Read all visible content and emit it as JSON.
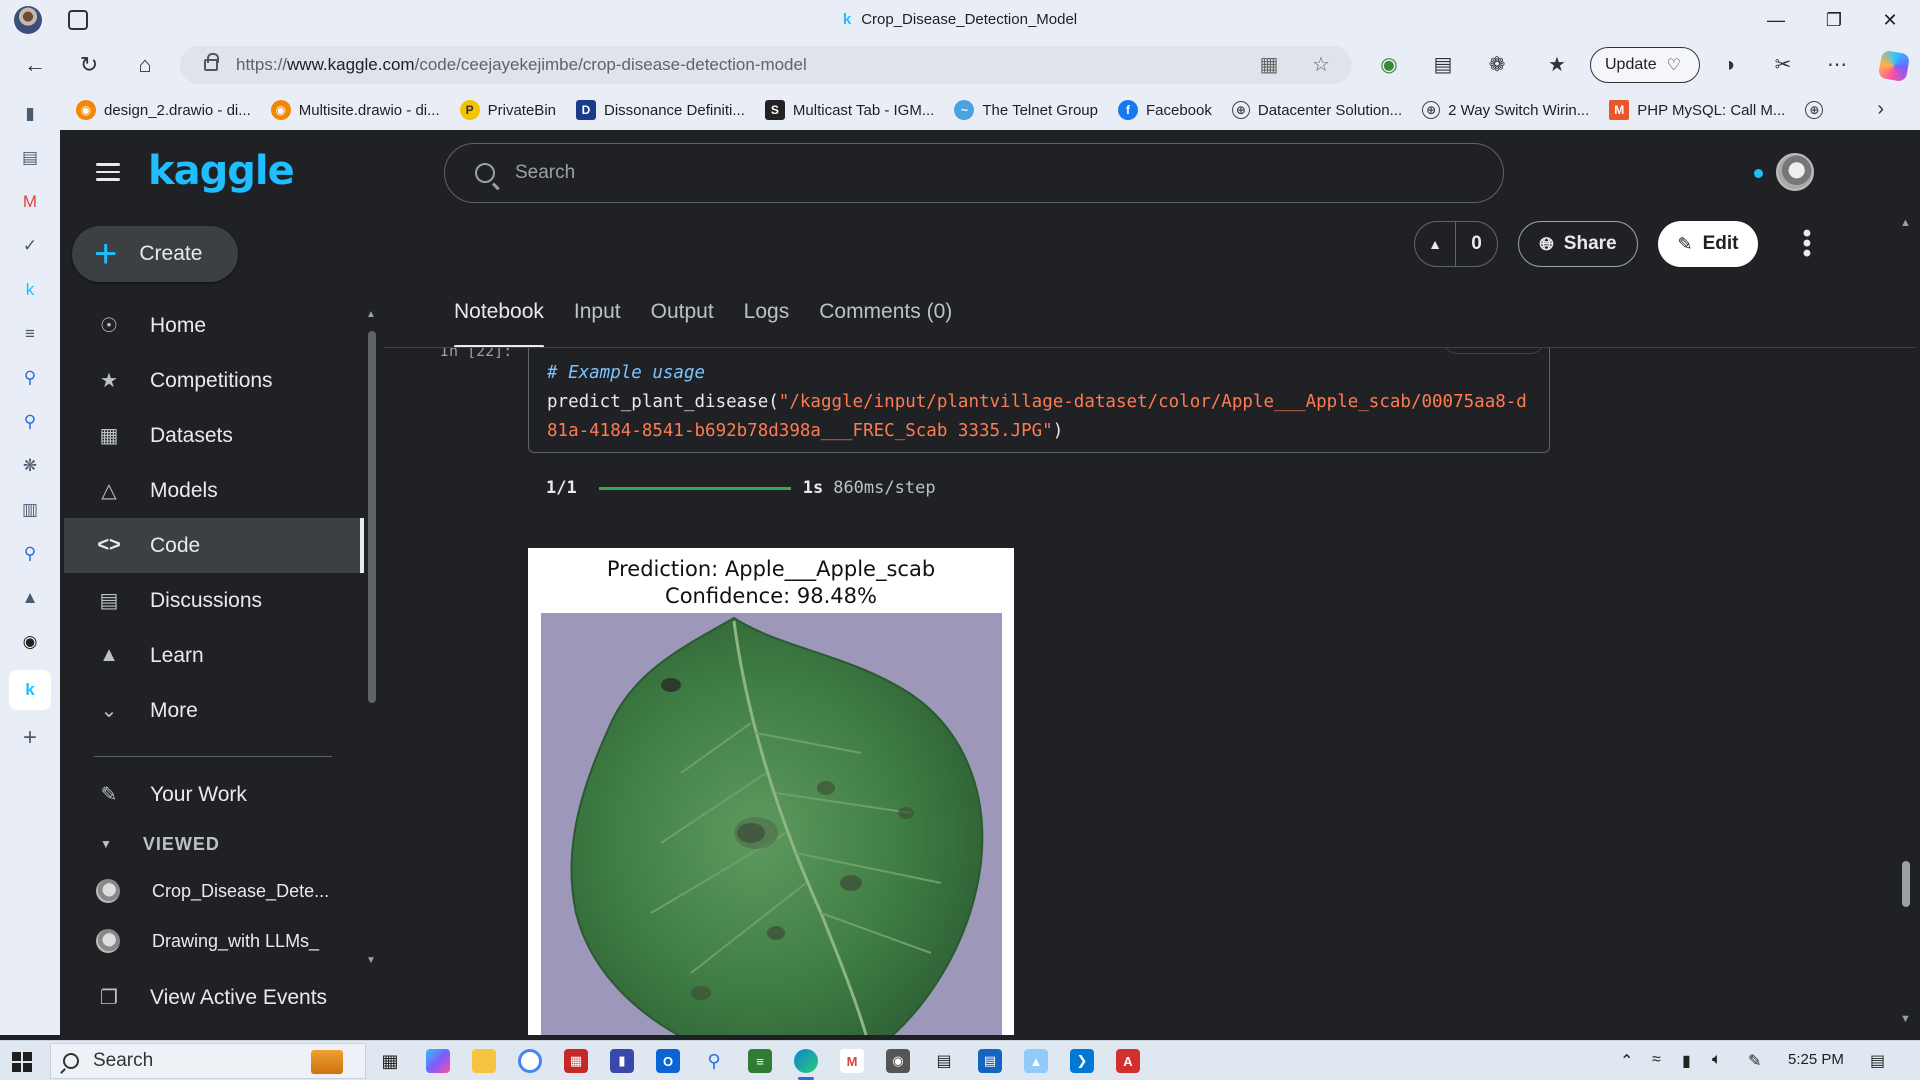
{
  "window": {
    "title": "Crop_Disease_Detection_Model",
    "tab_icon_letter": "k"
  },
  "address": {
    "url_prefix": "https://",
    "url_host": "www.kaggle.com",
    "url_path": "/code/ceejayekejimbe/crop-disease-detection-model"
  },
  "toolbar": {
    "update_label": "Update"
  },
  "bookmarks": [
    {
      "label": "design_2.drawio - di...",
      "icon": "drawio-icon",
      "color": "#f08705"
    },
    {
      "label": "Multisite.drawio - di...",
      "icon": "drawio-icon",
      "color": "#f08705"
    },
    {
      "label": "PrivateBin",
      "icon": "privatebin-icon",
      "color": "#f5c400"
    },
    {
      "label": "Dissonance Definiti...",
      "icon": "dictionary-icon",
      "color": "#1a3a8a"
    },
    {
      "label": "Multicast Tab - IGM...",
      "icon": "s-icon",
      "color": "#222222"
    },
    {
      "label": "The Telnet Group",
      "icon": "telnet-icon",
      "color": "#4aa3df"
    },
    {
      "label": "Facebook",
      "icon": "facebook-icon",
      "color": "#1877f2"
    },
    {
      "label": "Datacenter Solution...",
      "icon": "globe-icon",
      "color": "#444444"
    },
    {
      "label": "2 Way Switch Wirin...",
      "icon": "globe-icon",
      "color": "#444444"
    },
    {
      "label": "PHP MySQL: Call M...",
      "icon": "php-icon",
      "color": "#e8572a"
    }
  ],
  "kaggle": {
    "logo": "kaggle",
    "create_label": "Create",
    "search_placeholder": "Search",
    "nav": [
      {
        "label": "Home",
        "icon": "compass-icon",
        "active": false
      },
      {
        "label": "Competitions",
        "icon": "trophy-icon",
        "active": false
      },
      {
        "label": "Datasets",
        "icon": "table-icon",
        "active": false
      },
      {
        "label": "Models",
        "icon": "models-icon",
        "active": false
      },
      {
        "label": "Code",
        "icon": "code-icon",
        "active": true
      },
      {
        "label": "Discussions",
        "icon": "discussions-icon",
        "active": false
      },
      {
        "label": "Learn",
        "icon": "learn-icon",
        "active": false
      },
      {
        "label": "More",
        "icon": "chevron-down-icon",
        "active": false
      }
    ],
    "your_work_label": "Your Work",
    "viewed_header": "VIEWED",
    "viewed": [
      {
        "label": "Crop_Disease_Dete..."
      },
      {
        "label": "Drawing_with LLMs_"
      }
    ],
    "view_active_events_label": "View Active Events",
    "vote_count": "0",
    "share_label": "Share",
    "edit_label": "Edit",
    "tabs": [
      "Notebook",
      "Input",
      "Output",
      "Logs",
      "Comments (0)"
    ],
    "active_tab": "Notebook"
  },
  "notebook": {
    "cell_number": "In [22]:",
    "code_comment": "# Example usage",
    "code_fn": "predict_plant_disease(",
    "code_string_line1": "\"/kaggle/input/plantvillage-dataset/color/Apple___Apple_scab/00075aa8-d",
    "code_string_line2": "81a-4184-8541-b692b78d398a___FREC_Scab 3335.JPG\"",
    "code_close": ")",
    "progress": {
      "step": "1/1",
      "fraction": 1.0,
      "time": "1s",
      "rate": "860ms/step"
    },
    "figure": {
      "prediction": "Prediction: Apple___Apple_scab",
      "confidence": "Confidence: 98.48%"
    }
  },
  "taskbar": {
    "search_label": "Search",
    "clock": "5:25 PM"
  }
}
